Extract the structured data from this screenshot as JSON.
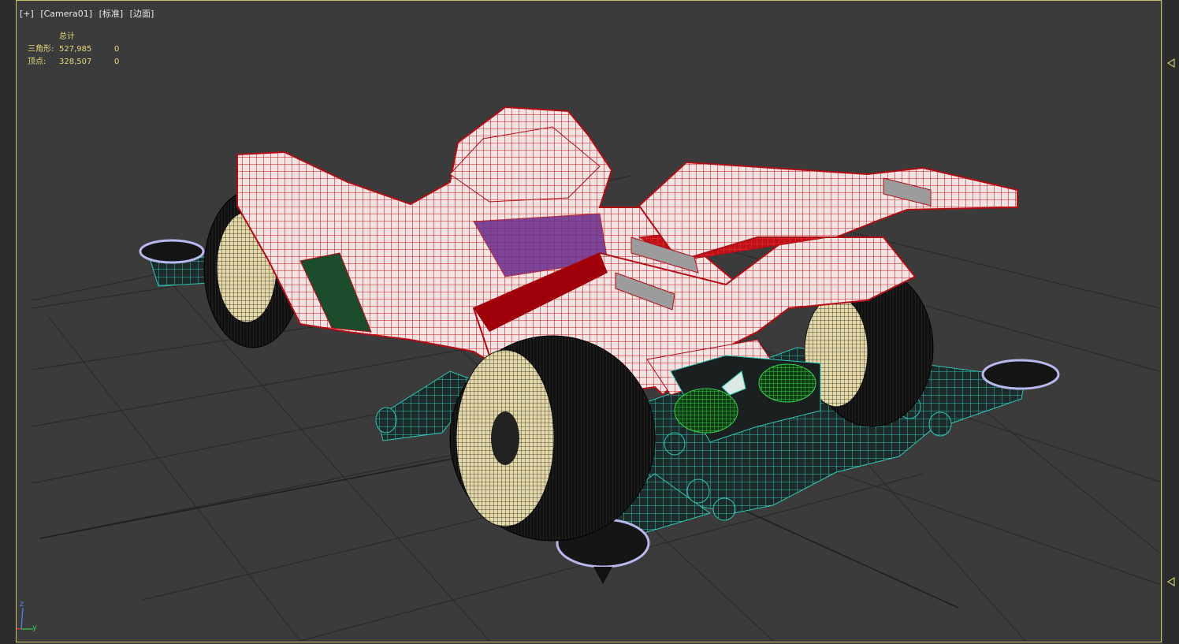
{
  "viewport": {
    "labels": [
      "[+]",
      "[Camera01]",
      "[标准]",
      "[边面]"
    ]
  },
  "stats": {
    "header": "总计",
    "rows": [
      {
        "label": "三角形:",
        "total": "527,985",
        "selected": "0"
      },
      {
        "label": "顶点:",
        "total": "328,507",
        "selected": "0"
      }
    ]
  },
  "axis": {
    "z": "z",
    "y": "y",
    "x": "x"
  },
  "colors": {
    "border": "#c9c36a",
    "stats": "#e8d87a",
    "body": "#c8191e",
    "chassis": "#2ec7b5",
    "grid": "#2a2a2a"
  },
  "icons": [
    "scroll-arrow-up-icon",
    "scroll-arrow-down-icon",
    "axis-gizmo-icon"
  ]
}
